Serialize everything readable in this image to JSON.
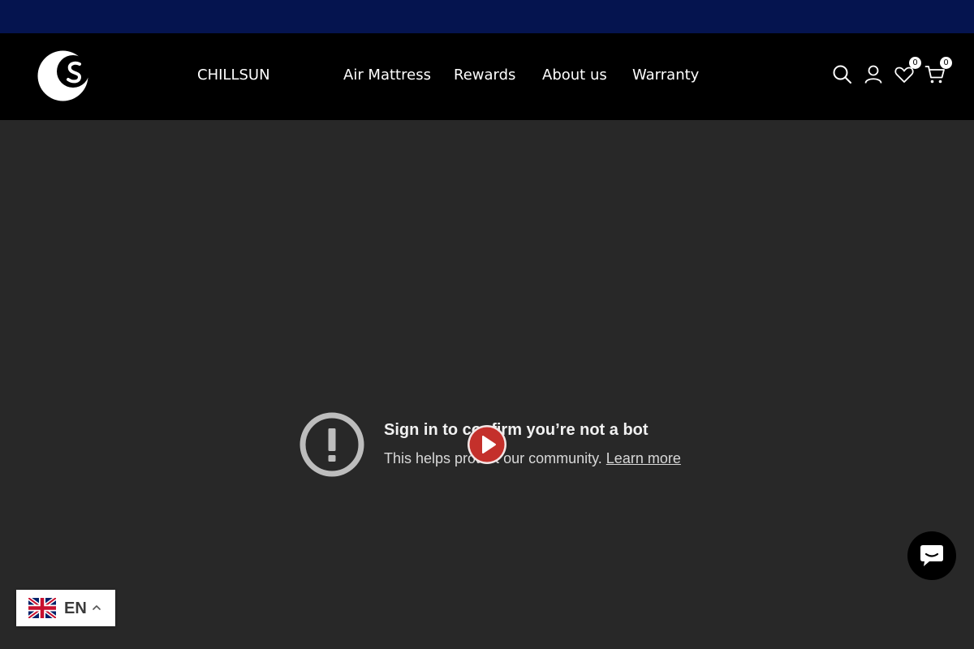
{
  "header": {
    "brand": "CHILLSUN",
    "nav": [
      {
        "label": "Air Mattress"
      },
      {
        "label": "Rewards"
      },
      {
        "label": "About us"
      },
      {
        "label": "Warranty"
      }
    ],
    "icons": {
      "search": "search-icon",
      "account": "user-icon",
      "wishlist": "heart-icon",
      "cart": "cart-icon"
    },
    "wishlist_count": "0",
    "cart_count": "0"
  },
  "video": {
    "title": "Sign in to confirm you’re not a bot",
    "subtitle": "This helps protect our community.",
    "link": "Learn more"
  },
  "language": {
    "code": "EN",
    "flag": "uk-flag-icon"
  },
  "colors": {
    "topbar": "#05144f",
    "header": "#000000",
    "video_bg": "#282828",
    "play_button": "#c4302b"
  }
}
